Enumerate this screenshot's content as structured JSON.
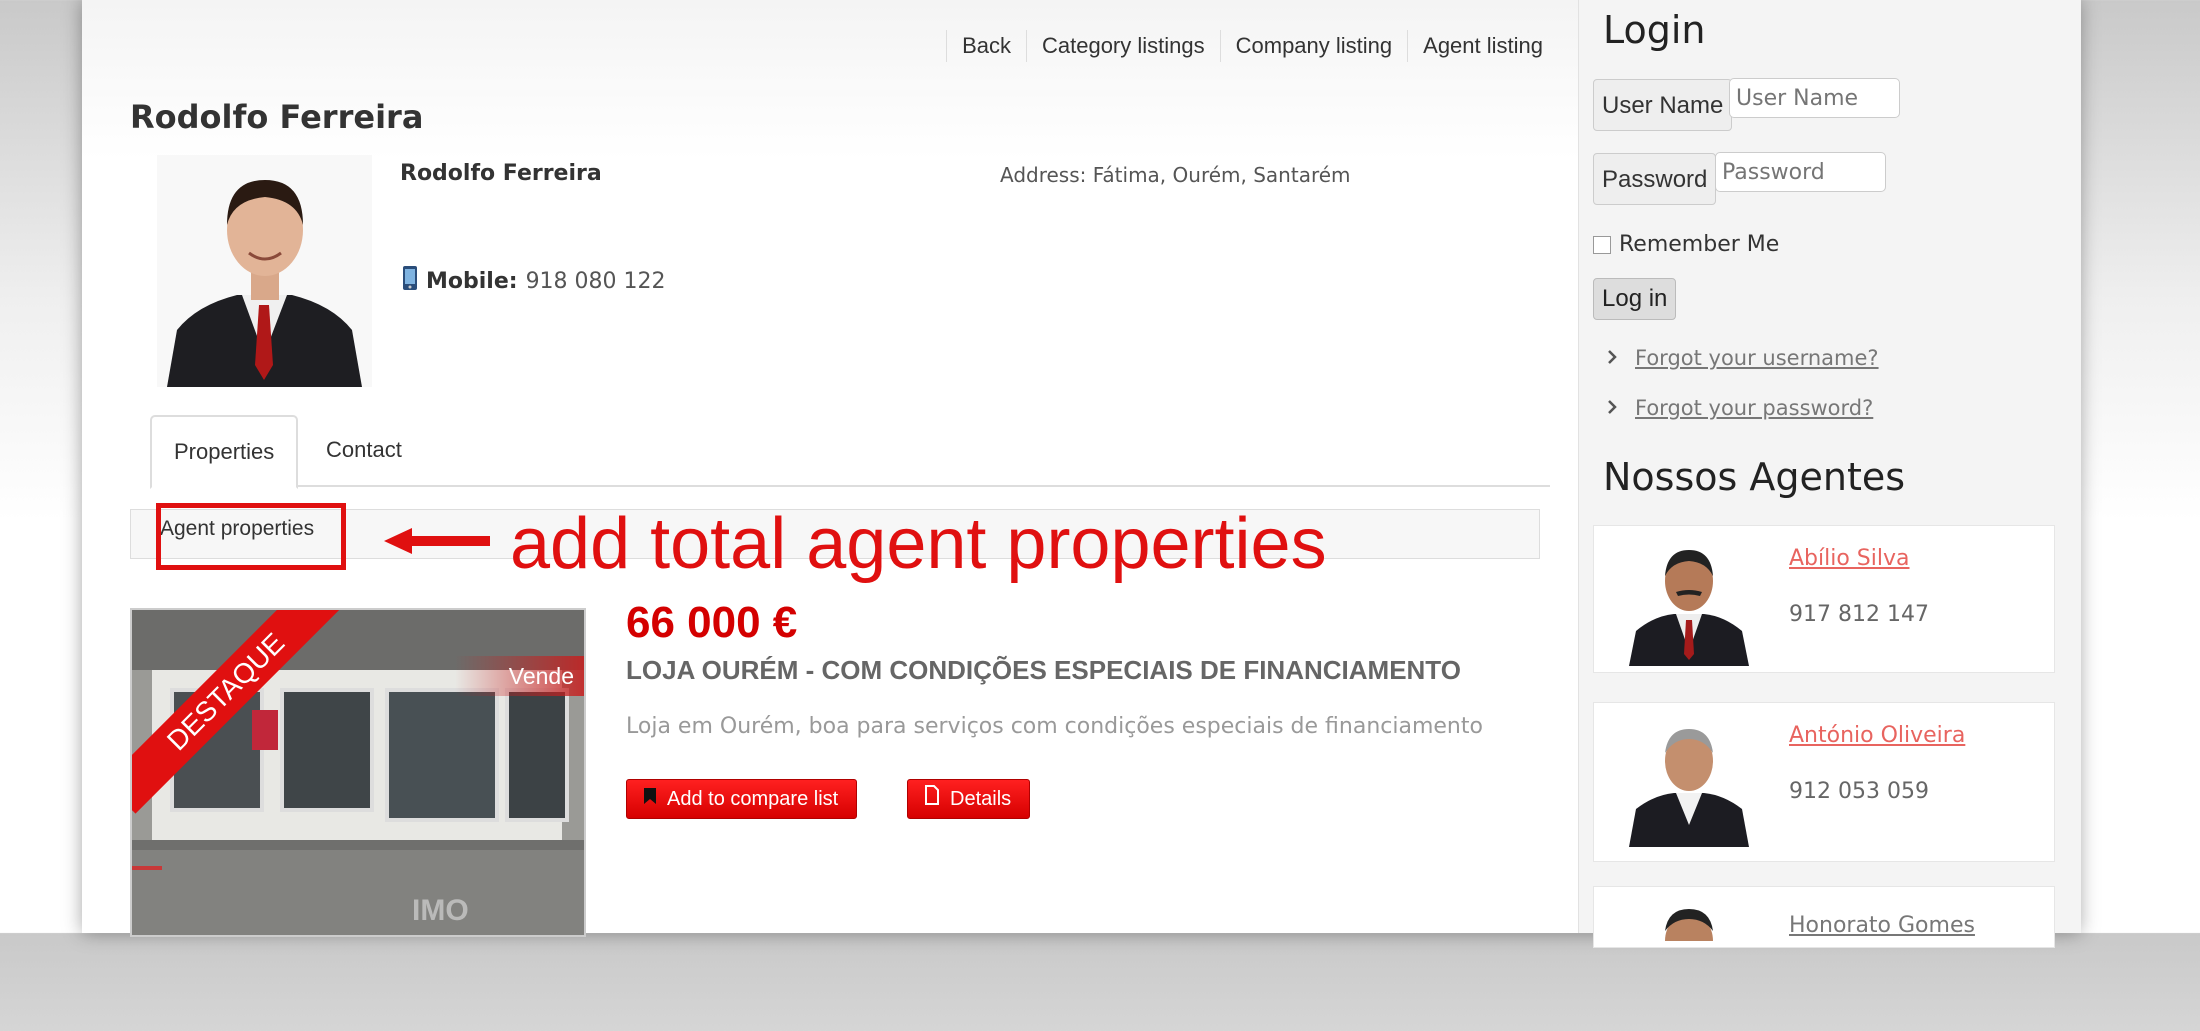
{
  "nav": {
    "back": "Back",
    "category": "Category listings",
    "company": "Company listing",
    "agent": "Agent listing"
  },
  "agent": {
    "title": "Rodolfo Ferreira",
    "name": "Rodolfo Ferreira",
    "address": "Address: Fátima, Ourém, Santarém",
    "mobile_label": "Mobile:",
    "mobile": "918 080 122"
  },
  "tabs": [
    "Properties",
    "Contact"
  ],
  "section": {
    "label": "Agent properties"
  },
  "annotation": "add total agent properties",
  "listing": {
    "badge": "DESTAQUE",
    "tag": "Vende",
    "price": "66 000 €",
    "title": "LOJA OURÉM - COM CONDIÇÕES ESPECIAIS DE FINANCIAMENTO",
    "description": "Loja em Ourém, boa para serviços com condições especiais de financiamento",
    "compare_label": "Add to compare list",
    "details_label": "Details"
  },
  "login": {
    "heading": "Login",
    "username_label": "User Name",
    "username_placeholder": "User Name",
    "password_label": "Password",
    "password_placeholder": "Password",
    "remember": "Remember Me",
    "submit": "Log in",
    "forgot_username": "Forgot your username?",
    "forgot_password": "Forgot your password?"
  },
  "agents_heading": "Nossos Agentes",
  "agents": [
    {
      "name": "Abílio Silva",
      "phone": "917 812 147"
    },
    {
      "name": "António Oliveira",
      "phone": "912 053 059"
    },
    {
      "name": "Honorato Gomes"
    }
  ],
  "colors": {
    "accent_red": "#e01010",
    "price_red": "#d40000",
    "link_salmon": "#e8645f"
  }
}
